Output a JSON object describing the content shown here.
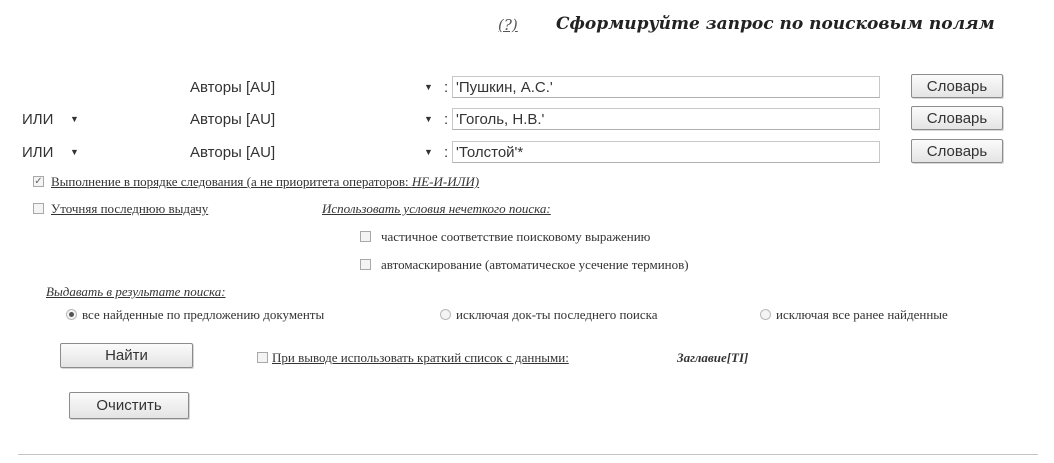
{
  "header": {
    "help_link": "(?)",
    "title": "Сформируйте запрос по поисковым полям"
  },
  "query_rows": [
    {
      "operator": "",
      "field": "Авторы [AU]",
      "value": "'Пушкин, А.С.'",
      "dict_label": "Словарь"
    },
    {
      "operator": "ИЛИ",
      "field": "Авторы [AU]",
      "value": "'Гоголь, Н.В.'",
      "dict_label": "Словарь"
    },
    {
      "operator": "ИЛИ",
      "field": "Авторы [AU]",
      "value": "'Толстой'*",
      "dict_label": "Словарь"
    }
  ],
  "separator": ":",
  "options": {
    "sequential": {
      "checked": true,
      "label": "Выполнение в порядке следования (а не приоритета операторов: ",
      "label_em": "НЕ-И-ИЛИ)"
    },
    "refine_last": {
      "checked": false,
      "label": "Уточняя последнюю выдачу"
    },
    "fuzzy_heading": "Использовать условия нечеткого поиска:",
    "partial_match": {
      "checked": false,
      "label": "частичное соответствие поисковому выражению"
    },
    "auto_mask": {
      "checked": false,
      "label": "автомаскирование (автоматическое усечение терминов)"
    }
  },
  "results": {
    "heading": "Выдавать в результате поиска:",
    "choices": [
      {
        "label": "все найденные по предложению документы",
        "selected": true
      },
      {
        "label": "исключая док-ты последнего поиска",
        "selected": false
      },
      {
        "label": "исключая все ранее найденные",
        "selected": false
      }
    ]
  },
  "actions": {
    "find": "Найти",
    "clear": "Очистить"
  },
  "brief_list": {
    "checked": false,
    "label": "При выводе использовать краткий список с данными:",
    "field": "Заглавие[TI]"
  }
}
